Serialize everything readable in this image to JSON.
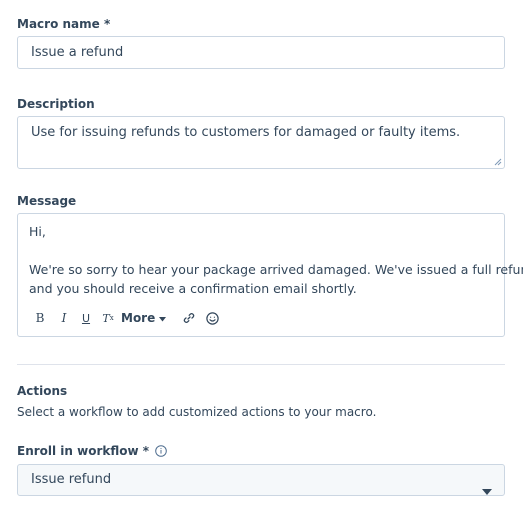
{
  "macro_name": {
    "label": "Macro name *",
    "value": "Issue a refund"
  },
  "description": {
    "label": "Description",
    "value": "Use for issuing refunds to customers for damaged or faulty items."
  },
  "message": {
    "label": "Message",
    "line1": "Hi,",
    "line2": "We're so sorry to hear your package arrived damaged. We've issued a full refund,",
    "line3": "and you should receive a confirmation email shortly.",
    "toolbar": {
      "bold": "B",
      "italic": "I",
      "underline": "U",
      "clear_format": "T",
      "clear_format_sub": "x",
      "more": "More",
      "more_caret": "▾",
      "link_icon": "link-icon",
      "emoji_icon": "emoji-icon"
    }
  },
  "actions": {
    "title": "Actions",
    "description": "Select a workflow to add customized actions to your macro."
  },
  "workflow": {
    "label": "Enroll in workflow *",
    "selected": "Issue refund",
    "info_icon": "info-icon",
    "caret_icon": "caret-down-icon"
  },
  "colors": {
    "text": "#33475b",
    "border": "#cbd6e2",
    "select_bg": "#f5f8fa",
    "divider": "#dfe3eb"
  }
}
